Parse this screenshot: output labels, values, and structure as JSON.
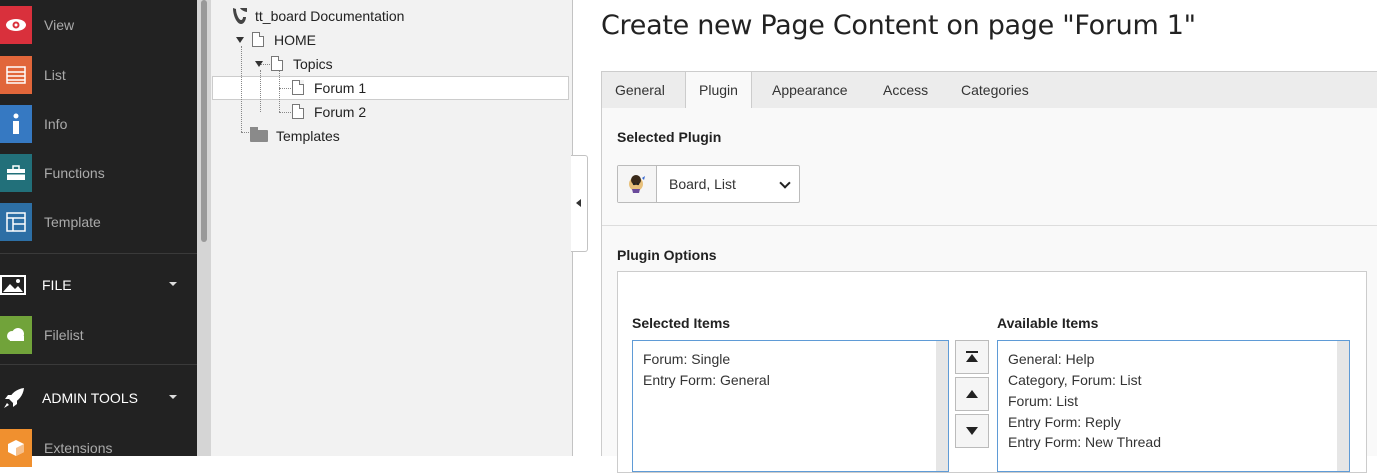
{
  "module_menu": {
    "items": [
      {
        "label": "View",
        "icon": "eye-icon",
        "color": "#d9303c"
      },
      {
        "label": "List",
        "icon": "list-icon",
        "color": "#e1663a"
      },
      {
        "label": "Info",
        "icon": "info-icon",
        "color": "#3679c2"
      },
      {
        "label": "Functions",
        "icon": "briefcase-icon",
        "color": "#22707a"
      },
      {
        "label": "Template",
        "icon": "template-icon",
        "color": "#2d6fa5"
      }
    ],
    "group_file": "FILE",
    "filelist": {
      "label": "Filelist",
      "icon": "cloud-icon",
      "color": "#71a33a"
    },
    "group_admin": "ADMIN TOOLS",
    "extensions": {
      "label": "Extensions",
      "icon": "extensions-icon",
      "color": "#f0902f"
    }
  },
  "page_tree": {
    "root": "tt_board Documentation",
    "nodes": [
      "HOME",
      "Topics",
      "Forum 1",
      "Forum 2",
      "Templates"
    ]
  },
  "main": {
    "title": "Create new Page Content on page \"Forum 1\"",
    "tabs": [
      "General",
      "Plugin",
      "Appearance",
      "Access",
      "Categories"
    ],
    "active_tab": "Plugin",
    "selected_plugin_label": "Selected Plugin",
    "plugin_value": "Board, List",
    "plugin_options_label": "Plugin Options",
    "selected_items_label": "Selected Items",
    "available_items_label": "Available Items",
    "selected_items": [
      "Forum: Single",
      "Entry Form: General"
    ],
    "available_items": [
      "General: Help",
      "Category, Forum: List",
      "Forum: List",
      "Entry Form: Reply",
      "Entry Form: New Thread"
    ]
  },
  "colors": {
    "accent": "#5f9bd6",
    "sidebar_bg": "#222222",
    "tree_bg": "#f2f2f2"
  }
}
